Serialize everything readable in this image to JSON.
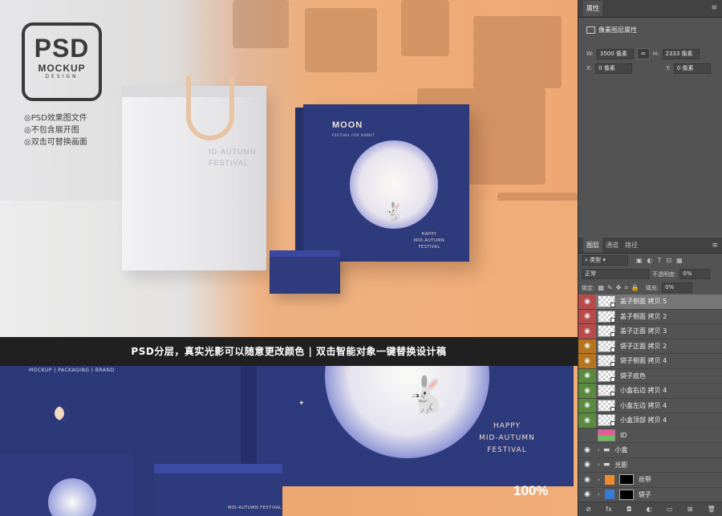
{
  "scene": {
    "logo": {
      "psd": "PSD",
      "mockup": "MOCKUP",
      "design": "DESIGN"
    },
    "features": [
      "◎PSD效果图文件",
      "◎不包含展开图",
      "◎双击可替换画面"
    ],
    "bag_text": [
      "ID-AUTUMN",
      "FESTIVAL"
    ],
    "box": {
      "moon": "MOON",
      "moon_sub": "FESTIVAL FOR RABBIT",
      "festival": [
        "HAPPY",
        "MID-AUTUMN",
        "FESTIVAL"
      ]
    },
    "banner": "PSD分层，真实光影可以随意更改颜色 | 双击智能对象一键替换设计稿",
    "bottom_nav": "MOCKUP | PACKAGING | BRAND",
    "hero_festival": [
      "HAPPY",
      "MID-AUTUMN",
      "FESTIVAL"
    ],
    "small_box_text": "MID-AUTUMN FESTIVAL",
    "zoom": "100%"
  },
  "props_panel": {
    "tab": "属性",
    "section_title": "像素图层属性",
    "w_label": "W:",
    "w_value": "3500 像素",
    "h_label": "H:",
    "h_value": "2333 像素",
    "x_label": "X:",
    "x_value": "0 像素",
    "y_label": "Y:",
    "y_value": "0 像素"
  },
  "layers_panel": {
    "tabs": [
      "图层",
      "通道",
      "路径"
    ],
    "filter_label": "类型",
    "blend_mode": "正常",
    "opacity_label": "不透明度:",
    "opacity_value": "0%",
    "lock_label": "锁定:",
    "fill_label": "填充:",
    "fill_value": "0%",
    "layers": [
      {
        "name": "盖子侧面 拷贝 5",
        "color": "#b84a4a",
        "selected": true
      },
      {
        "name": "盖子侧面 拷贝 2",
        "color": "#b84a4a"
      },
      {
        "name": "盖子正面 拷贝 3",
        "color": "#b84a4a"
      },
      {
        "name": "袋子正面 拷贝 2",
        "color": "#b5741d"
      },
      {
        "name": "袋子侧面 拷贝 4",
        "color": "#b5741d"
      },
      {
        "name": "袋子底色",
        "color": "#5a8a3e"
      },
      {
        "name": "小盒右边 拷贝 4",
        "color": "#5a8a3e"
      },
      {
        "name": "小盒左边 拷贝 4",
        "color": "#5a8a3e"
      },
      {
        "name": "小盒顶部 拷贝 4",
        "color": "#5a8a3e"
      },
      {
        "name": "ID",
        "color": ""
      },
      {
        "name": "小盒",
        "color": ""
      },
      {
        "name": "光影",
        "color": ""
      },
      {
        "name": "丝带",
        "color": ""
      },
      {
        "name": "袋子",
        "color": ""
      }
    ]
  }
}
